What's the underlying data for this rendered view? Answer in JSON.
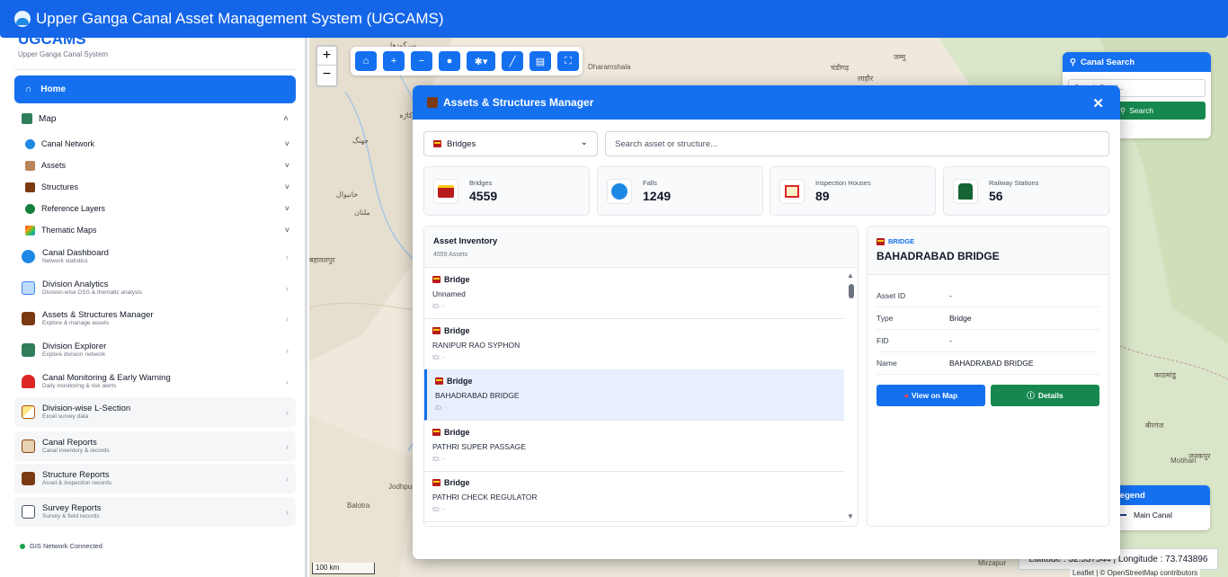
{
  "app": {
    "title": "Upper Ganga Canal Asset Management System (UGCAMS)"
  },
  "sidebar": {
    "brand": "UGCAMS",
    "brand_sub": "Upper Ganga Canal System",
    "home_label": "Home",
    "map_label": "Map",
    "map_sub_items": [
      {
        "label": "Canal Network",
        "icon": "water-wave-icon"
      },
      {
        "label": "Assets",
        "icon": "box-icon"
      },
      {
        "label": "Structures",
        "icon": "structure-icon"
      },
      {
        "label": "Reference Layers",
        "icon": "globe-icon"
      },
      {
        "label": "Thematic Maps",
        "icon": "rainbow-icon"
      }
    ],
    "nav_items": [
      {
        "title": "Canal Dashboard",
        "subtitle": "Network statistics"
      },
      {
        "title": "Division Analytics",
        "subtitle": "Division-wise DSS & thematic analysis"
      },
      {
        "title": "Assets & Structures Manager",
        "subtitle": "Explore & manage assets"
      },
      {
        "title": "Division Explorer",
        "subtitle": "Explore division network"
      },
      {
        "title": "Canal Monitoring & Early Warning",
        "subtitle": "Daily monitoring & risk alerts"
      },
      {
        "title": "Division-wise L-Section",
        "subtitle": "Excel survey data"
      },
      {
        "title": "Canal Reports",
        "subtitle": "Canal inventory & records"
      },
      {
        "title": "Structure Reports",
        "subtitle": "Asset & inspection records"
      },
      {
        "title": "Survey Reports",
        "subtitle": "Survey & field records"
      }
    ],
    "status_text": "GIS Network Connected"
  },
  "map": {
    "labels": [
      "Dharamshala",
      "Jodhpur",
      "Balotra",
      "Mirzapur",
      "Motihari",
      "जम्मू",
      "चंडीगढ़",
      "लाहौर",
      "काठमांडू",
      "बीरगंज",
      "जनकपुर",
      "बहावलपुर",
      "سرگودھا",
      "جھنگ",
      "اوکاڑہ",
      "ملتان",
      "خانیوال"
    ],
    "zoom_in": "+",
    "zoom_out": "−",
    "scale_label": "100 km",
    "coordinates": "Latitude : 32.537544 | Longitude : 73.743896",
    "attribution": "Leaflet | © OpenStreetMap contributors",
    "canal_search": {
      "title": "Canal Search",
      "placeholder": "Search Canal...",
      "button": "Search"
    },
    "legend": {
      "title": "Legend",
      "items": [
        "Main Canal"
      ]
    }
  },
  "modal": {
    "title": "Assets & Structures Manager",
    "close_label": "✕",
    "category_selected": "Bridges",
    "search_placeholder": "Search asset or structure...",
    "stats": [
      {
        "label": "Bridges",
        "value": "4559",
        "icon": "bridge-icon"
      },
      {
        "label": "Falls",
        "value": "1249",
        "icon": "wave-icon"
      },
      {
        "label": "Inspection Houses",
        "value": "89",
        "icon": "house-icon"
      },
      {
        "label": "Railway Stations",
        "value": "56",
        "icon": "train-icon"
      }
    ],
    "inventory": {
      "title": "Asset Inventory",
      "count": "4559 Assets",
      "items": [
        {
          "type": "Bridge",
          "name": "Unnamed",
          "id": "ID: -"
        },
        {
          "type": "Bridge",
          "name": "RANIPUR RAO SYPHON",
          "id": "ID: -"
        },
        {
          "type": "Bridge",
          "name": "BAHADRABAD BRIDGE",
          "id": "ID: -",
          "selected": true
        },
        {
          "type": "Bridge",
          "name": "PATHRI SUPER PASSAGE",
          "id": "ID: -"
        },
        {
          "type": "Bridge",
          "name": "PATHRI CHECK REGULATOR",
          "id": "ID: -"
        }
      ]
    },
    "detail": {
      "category": "BRIDGE",
      "title": "BAHADRABAD BRIDGE",
      "fields": [
        {
          "key": "Asset ID",
          "value": "-"
        },
        {
          "key": "Type",
          "value": "Bridge"
        },
        {
          "key": "FID",
          "value": "-"
        },
        {
          "key": "Name",
          "value": "BAHADRABAD BRIDGE"
        }
      ],
      "view_on_map": "View on Map",
      "details": "Details"
    }
  },
  "colors": {
    "primary": "#1570f0",
    "success": "#16884f",
    "header": "#1565e8"
  }
}
